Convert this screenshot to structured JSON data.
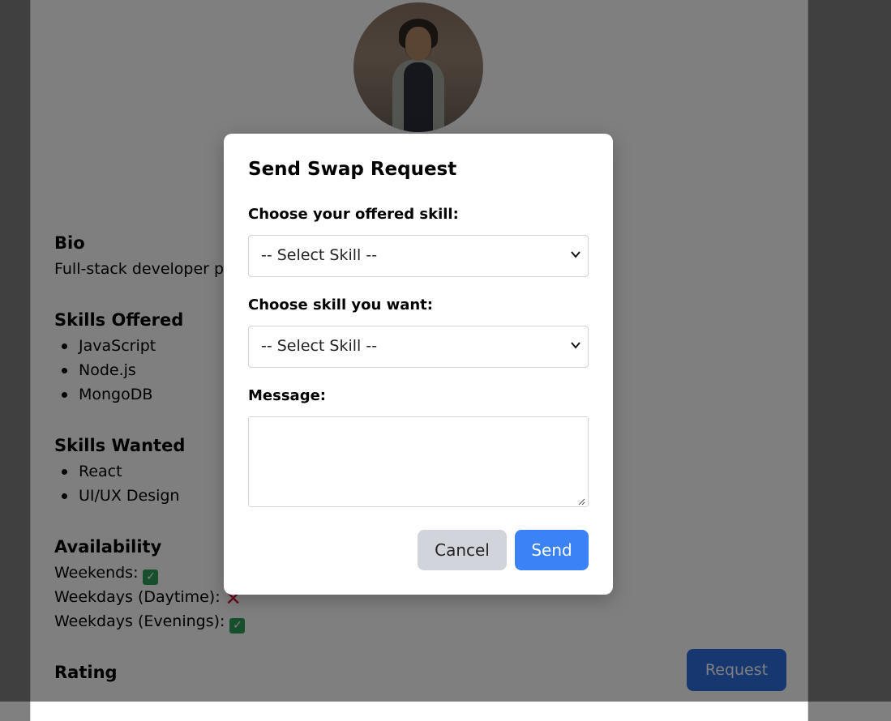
{
  "profile": {
    "bio_title": "Bio",
    "bio_text": "Full-stack developer p",
    "skills_offered_title": "Skills Offered",
    "skills_offered": [
      "JavaScript",
      "Node.js",
      "MongoDB"
    ],
    "skills_wanted_title": "Skills Wanted",
    "skills_wanted": [
      "React",
      "UI/UX Design"
    ],
    "availability_title": "Availability",
    "availability": [
      {
        "label": "Weekends:",
        "status": "yes"
      },
      {
        "label": "Weekdays (Daytime):",
        "status": "no"
      },
      {
        "label": "Weekdays (Evenings):",
        "status": "yes"
      }
    ],
    "rating_title": "Rating",
    "request_button": "Request"
  },
  "modal": {
    "title": "Send Swap Request",
    "offered_label": "Choose your offered skill:",
    "offered_value": "-- Select Skill --",
    "wanted_label": "Choose skill you want:",
    "wanted_value": "-- Select Skill --",
    "message_label": "Message:",
    "message_value": "",
    "cancel_label": "Cancel",
    "send_label": "Send"
  },
  "colors": {
    "accent": "#3b82f6",
    "request_button": "#2f6fe0",
    "cancel_button": "#d1d5db",
    "check": "#2e9e5b",
    "cross": "#c8102e"
  }
}
